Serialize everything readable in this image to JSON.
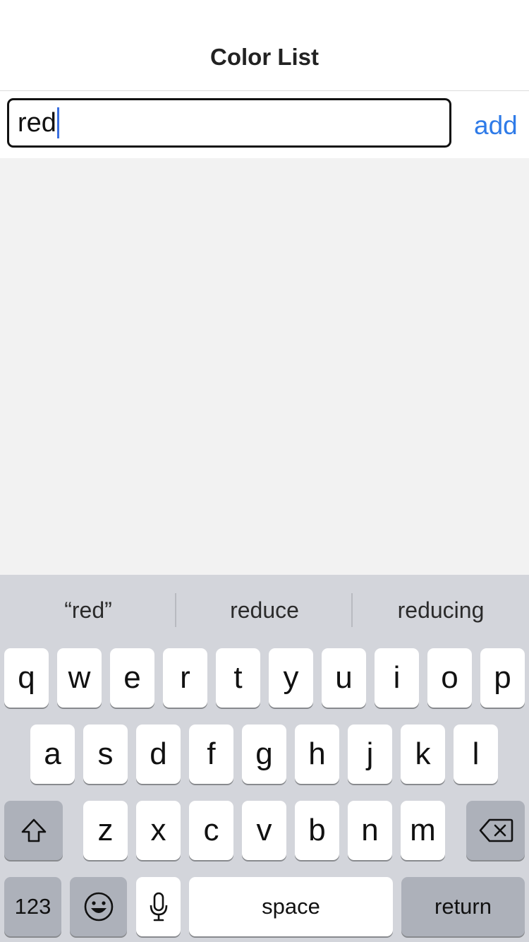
{
  "nav": {
    "title": "Color List"
  },
  "input_row": {
    "field_value": "red",
    "add_label": "add"
  },
  "keyboard": {
    "suggestions": [
      "“red”",
      "reduce",
      "reducing"
    ],
    "row1": [
      "q",
      "w",
      "e",
      "r",
      "t",
      "y",
      "u",
      "i",
      "o",
      "p"
    ],
    "row2": [
      "a",
      "s",
      "d",
      "f",
      "g",
      "h",
      "j",
      "k",
      "l"
    ],
    "row3": [
      "z",
      "x",
      "c",
      "v",
      "b",
      "n",
      "m"
    ],
    "numbers_label": "123",
    "space_label": "space",
    "return_label": "return",
    "icons": {
      "shift": "shift-icon",
      "delete": "backspace-icon",
      "emoji": "emoji-icon",
      "mic": "microphone-icon"
    }
  },
  "colors": {
    "accent": "#2f7be8",
    "caret": "#3a6fe0",
    "content_bg": "#f2f2f2",
    "keyboard_bg": "#d3d5db",
    "key_dark": "#adb1ba"
  }
}
